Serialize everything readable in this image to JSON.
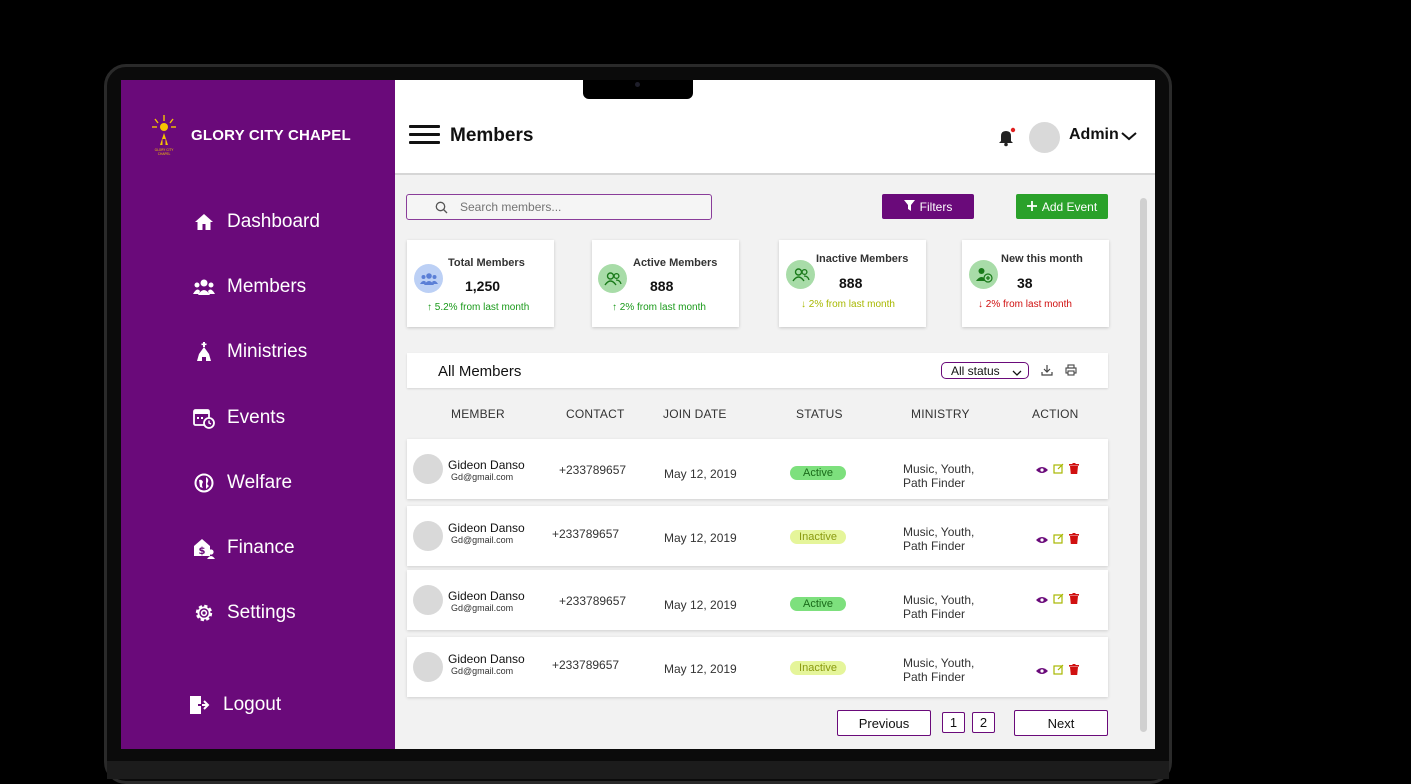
{
  "brand": {
    "name": "GLORY CITY CHAPEL"
  },
  "sidebar": {
    "items": [
      {
        "label": "Dashboard",
        "icon": "home-icon"
      },
      {
        "label": "Members",
        "icon": "users-icon"
      },
      {
        "label": "Ministries",
        "icon": "church-icon"
      },
      {
        "label": "Events",
        "icon": "calendar-clock-icon"
      },
      {
        "label": "Welfare",
        "icon": "globe-icon"
      },
      {
        "label": "Finance",
        "icon": "finance-icon"
      },
      {
        "label": "Settings",
        "icon": "gear-icon"
      }
    ],
    "logout": "Logout"
  },
  "header": {
    "title": "Members",
    "user": "Admin"
  },
  "search": {
    "placeholder": "Search members..."
  },
  "toolbar": {
    "filters": "Filters",
    "add_event": "Add Event"
  },
  "stats": [
    {
      "label": "Total Members",
      "value": "1,250",
      "change": "5.2% from last month",
      "trend": "up",
      "color": "#1a9a1a"
    },
    {
      "label": "Active Members",
      "value": "888",
      "change": "2% from last month",
      "trend": "up",
      "color": "#1a9a1a"
    },
    {
      "label": "Inactive Members",
      "value": "888",
      "change": "2% from last month",
      "trend": "down",
      "color": "#a8b800"
    },
    {
      "label": "New this month",
      "value": "38",
      "change": "2% from last month",
      "trend": "down",
      "color": "#d01010"
    }
  ],
  "table": {
    "title": "All Members",
    "status_filter": "All status",
    "columns": [
      "MEMBER",
      "CONTACT",
      "JOIN DATE",
      "STATUS",
      "MINISTRY",
      "ACTION"
    ],
    "rows": [
      {
        "name": "Gideon Danso",
        "email": "Gd@gmail.com",
        "contact": "+233789657",
        "join_date": "May 12, 2019",
        "status": "Active",
        "ministry_1": "Music, Youth,",
        "ministry_2": "Path Finder"
      },
      {
        "name": "Gideon Danso",
        "email": "Gd@gmail.com",
        "contact": "+233789657",
        "join_date": "May 12, 2019",
        "status": "Inactive",
        "ministry_1": "Music, Youth,",
        "ministry_2": "Path Finder"
      },
      {
        "name": "Gideon Danso",
        "email": "Gd@gmail.com",
        "contact": "+233789657",
        "join_date": "May 12, 2019",
        "status": "Active",
        "ministry_1": "Music, Youth,",
        "ministry_2": "Path Finder"
      },
      {
        "name": "Gideon Danso",
        "email": "Gd@gmail.com",
        "contact": "+233789657",
        "join_date": "May 12, 2019",
        "status": "Inactive",
        "ministry_1": "Music, Youth,",
        "ministry_2": "Path Finder"
      }
    ]
  },
  "pagination": {
    "previous": "Previous",
    "pages": [
      "1",
      "2"
    ],
    "next": "Next"
  },
  "colors": {
    "brand": "#6a0a7a",
    "add": "#2aa12a",
    "active_badge": "#7de07d",
    "inactive_badge": "#e5f59a"
  }
}
